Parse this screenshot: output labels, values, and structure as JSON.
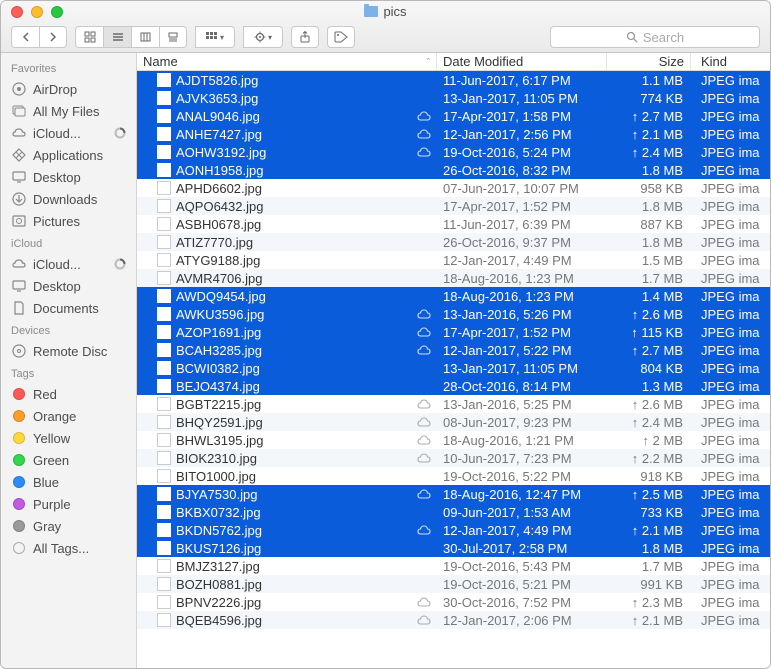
{
  "window": {
    "title": "pics"
  },
  "search": {
    "placeholder": "Search"
  },
  "columns": {
    "name": "Name",
    "date": "Date Modified",
    "size": "Size",
    "kind": "Kind"
  },
  "sidebar": {
    "sections": [
      {
        "label": "Favorites",
        "items": [
          {
            "icon": "airdrop",
            "label": "AirDrop"
          },
          {
            "icon": "allfiles",
            "label": "All My Files"
          },
          {
            "icon": "cloud",
            "label": "iCloud...",
            "trail": "loading"
          },
          {
            "icon": "apps",
            "label": "Applications"
          },
          {
            "icon": "desktop",
            "label": "Desktop"
          },
          {
            "icon": "downloads",
            "label": "Downloads"
          },
          {
            "icon": "pictures",
            "label": "Pictures"
          }
        ]
      },
      {
        "label": "iCloud",
        "items": [
          {
            "icon": "cloud",
            "label": "iCloud...",
            "trail": "loading"
          },
          {
            "icon": "desktop",
            "label": "Desktop"
          },
          {
            "icon": "documents",
            "label": "Documents"
          }
        ]
      },
      {
        "label": "Devices",
        "items": [
          {
            "icon": "disc",
            "label": "Remote Disc"
          }
        ]
      },
      {
        "label": "Tags",
        "items": [
          {
            "icon": "tag",
            "color": "#ff5b56",
            "label": "Red"
          },
          {
            "icon": "tag",
            "color": "#ff9e2e",
            "label": "Orange"
          },
          {
            "icon": "tag",
            "color": "#ffd93a",
            "label": "Yellow"
          },
          {
            "icon": "tag",
            "color": "#32d74b",
            "label": "Green"
          },
          {
            "icon": "tag",
            "color": "#2e8bff",
            "label": "Blue"
          },
          {
            "icon": "tag",
            "color": "#c25bdf",
            "label": "Purple"
          },
          {
            "icon": "tag",
            "color": "#9a9a9a",
            "label": "Gray"
          },
          {
            "icon": "alltags",
            "label": "All Tags..."
          }
        ]
      }
    ]
  },
  "kind_text": "JPEG ima",
  "files": [
    {
      "name": "AJDT5826.jpg",
      "date": "11-Jun-2017, 6:17 PM",
      "size": "1.1 MB",
      "sel": true,
      "cloud": false,
      "up": false
    },
    {
      "name": "AJVK3653.jpg",
      "date": "13-Jan-2017, 11:05 PM",
      "size": "774 KB",
      "sel": true,
      "cloud": false,
      "up": false
    },
    {
      "name": "ANAL9046.jpg",
      "date": "17-Apr-2017, 1:58 PM",
      "size": "2.7 MB",
      "sel": true,
      "cloud": true,
      "up": true
    },
    {
      "name": "ANHE7427.jpg",
      "date": "12-Jan-2017, 2:56 PM",
      "size": "2.1 MB",
      "sel": true,
      "cloud": true,
      "up": true
    },
    {
      "name": "AOHW3192.jpg",
      "date": "19-Oct-2016, 5:24 PM",
      "size": "2.4 MB",
      "sel": true,
      "cloud": true,
      "up": true
    },
    {
      "name": "AONH1958.jpg",
      "date": "26-Oct-2016, 8:32 PM",
      "size": "1.8 MB",
      "sel": true,
      "cloud": false,
      "up": false
    },
    {
      "name": "APHD6602.jpg",
      "date": "07-Jun-2017, 10:07 PM",
      "size": "958 KB",
      "sel": false,
      "cloud": false,
      "up": false
    },
    {
      "name": "AQPO6432.jpg",
      "date": "17-Apr-2017, 1:52 PM",
      "size": "1.8 MB",
      "sel": false,
      "cloud": false,
      "up": false
    },
    {
      "name": "ASBH0678.jpg",
      "date": "11-Jun-2017, 6:39 PM",
      "size": "887 KB",
      "sel": false,
      "cloud": false,
      "up": false
    },
    {
      "name": "ATIZ7770.jpg",
      "date": "26-Oct-2016, 9:37 PM",
      "size": "1.8 MB",
      "sel": false,
      "cloud": false,
      "up": false
    },
    {
      "name": "ATYG9188.jpg",
      "date": "12-Jan-2017, 4:49 PM",
      "size": "1.5 MB",
      "sel": false,
      "cloud": false,
      "up": false
    },
    {
      "name": "AVMR4706.jpg",
      "date": "18-Aug-2016, 1:23 PM",
      "size": "1.7 MB",
      "sel": false,
      "cloud": false,
      "up": false
    },
    {
      "name": "AWDQ9454.jpg",
      "date": "18-Aug-2016, 1:23 PM",
      "size": "1.4 MB",
      "sel": true,
      "cloud": false,
      "up": false
    },
    {
      "name": "AWKU3596.jpg",
      "date": "13-Jan-2016, 5:26 PM",
      "size": "2.6 MB",
      "sel": true,
      "cloud": true,
      "up": true
    },
    {
      "name": "AZOP1691.jpg",
      "date": "17-Apr-2017, 1:52 PM",
      "size": "115 KB",
      "sel": true,
      "cloud": true,
      "up": true
    },
    {
      "name": "BCAH3285.jpg",
      "date": "12-Jan-2017, 5:22 PM",
      "size": "2.7 MB",
      "sel": true,
      "cloud": true,
      "up": true
    },
    {
      "name": "BCWI0382.jpg",
      "date": "13-Jan-2017, 11:05 PM",
      "size": "804 KB",
      "sel": true,
      "cloud": false,
      "up": false
    },
    {
      "name": "BEJO4374.jpg",
      "date": "28-Oct-2016, 8:14 PM",
      "size": "1.3 MB",
      "sel": true,
      "cloud": false,
      "up": false
    },
    {
      "name": "BGBT2215.jpg",
      "date": "13-Jan-2016, 5:25 PM",
      "size": "2.6 MB",
      "sel": false,
      "cloud": true,
      "up": true
    },
    {
      "name": "BHQY2591.jpg",
      "date": "08-Jun-2017, 9:23 PM",
      "size": "2.4 MB",
      "sel": false,
      "cloud": true,
      "up": true
    },
    {
      "name": "BHWL3195.jpg",
      "date": "18-Aug-2016, 1:21 PM",
      "size": "2 MB",
      "sel": false,
      "cloud": true,
      "up": true
    },
    {
      "name": "BIOK2310.jpg",
      "date": "10-Jun-2017, 7:23 PM",
      "size": "2.2 MB",
      "sel": false,
      "cloud": true,
      "up": true
    },
    {
      "name": "BITO1000.jpg",
      "date": "19-Oct-2016, 5:22 PM",
      "size": "918 KB",
      "sel": false,
      "cloud": false,
      "up": false
    },
    {
      "name": "BJYA7530.jpg",
      "date": "18-Aug-2016, 12:47 PM",
      "size": "2.5 MB",
      "sel": true,
      "cloud": true,
      "up": true
    },
    {
      "name": "BKBX0732.jpg",
      "date": "09-Jun-2017, 1:53 AM",
      "size": "733 KB",
      "sel": true,
      "cloud": false,
      "up": false
    },
    {
      "name": "BKDN5762.jpg",
      "date": "12-Jan-2017, 4:49 PM",
      "size": "2.1 MB",
      "sel": true,
      "cloud": true,
      "up": true
    },
    {
      "name": "BKUS7126.jpg",
      "date": "30-Jul-2017, 2:58 PM",
      "size": "1.8 MB",
      "sel": true,
      "cloud": false,
      "up": false
    },
    {
      "name": "BMJZ3127.jpg",
      "date": "19-Oct-2016, 5:43 PM",
      "size": "1.7 MB",
      "sel": false,
      "cloud": false,
      "up": false
    },
    {
      "name": "BOZH0881.jpg",
      "date": "19-Oct-2016, 5:21 PM",
      "size": "991 KB",
      "sel": false,
      "cloud": false,
      "up": false
    },
    {
      "name": "BPNV2226.jpg",
      "date": "30-Oct-2016, 7:52 PM",
      "size": "2.3 MB",
      "sel": false,
      "cloud": true,
      "up": true
    },
    {
      "name": "BQEB4596.jpg",
      "date": "12-Jan-2017, 2:06 PM",
      "size": "2.1 MB",
      "sel": false,
      "cloud": true,
      "up": true
    }
  ]
}
